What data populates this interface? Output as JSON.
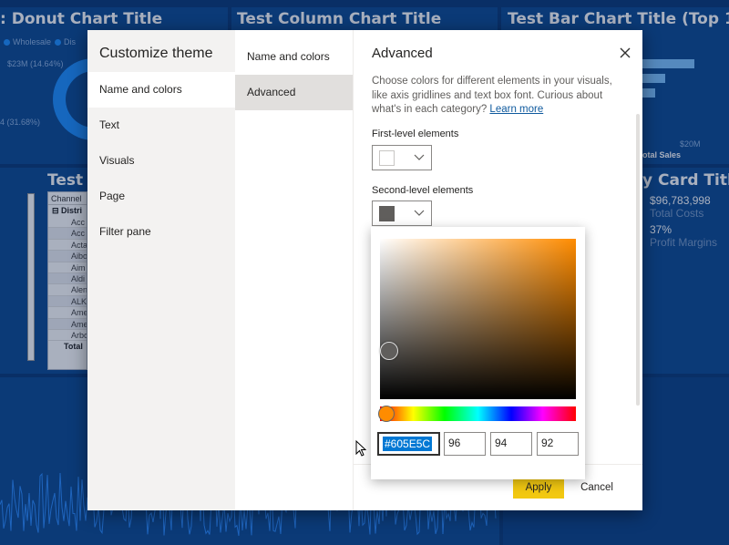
{
  "background": {
    "donut_title": ": Donut Chart Title",
    "column_title": "Test Column Chart Title",
    "bar_title": "Test Bar Chart Title (Top 10",
    "legend_wholesale": "Wholesale",
    "legend_dist": "Dis",
    "donut_label_top": "$23M (14.64%)",
    "donut_label_left": "4 (31.68%)",
    "bar_axis_20m": "$20M",
    "bar_axis_total_sales": "otal Sales",
    "table_title": "Test",
    "table_header": "Channel",
    "table_group": "Distri",
    "table_rows": [
      "Acc",
      "Acc",
      "Acta",
      "Aibo",
      "Aim",
      "Aldi",
      "Alen",
      "ALK",
      "Ame",
      "Ame",
      "Arbo"
    ],
    "table_total": "Total",
    "card_title": "y Card Title",
    "card_value1": "$96,783,998",
    "card_label1": "Total Costs",
    "card_value2": "37%",
    "card_label2": "Profit Margins"
  },
  "dialog": {
    "title": "Customize theme",
    "nav_primary": [
      {
        "label": "Name and colors",
        "selected": true
      },
      {
        "label": "Text",
        "selected": false
      },
      {
        "label": "Visuals",
        "selected": false
      },
      {
        "label": "Page",
        "selected": false
      },
      {
        "label": "Filter pane",
        "selected": false
      }
    ],
    "nav_secondary": [
      {
        "label": "Name and colors",
        "selected": false
      },
      {
        "label": "Advanced",
        "selected": true
      }
    ],
    "content_title": "Advanced",
    "description": "Choose colors for different elements in your visuals, like axis gridlines and text box font. Curious about what's in each category? ",
    "learn_more": "Learn more",
    "first_level_label": "First-level elements",
    "first_level_color": "#FFFFFF",
    "second_level_label": "Second-level elements",
    "second_level_color": "#605E5C",
    "apply_label": "Apply",
    "cancel_label": "Cancel"
  },
  "color_picker": {
    "hex": "#605E5C",
    "r": "96",
    "g": "94",
    "b": "92",
    "hue_color": "#FF8C00"
  },
  "colors": {
    "accent_yellow": "#F2C811",
    "dashboard_bg": "#0A3A78",
    "selection_blue": "#0078D4"
  }
}
